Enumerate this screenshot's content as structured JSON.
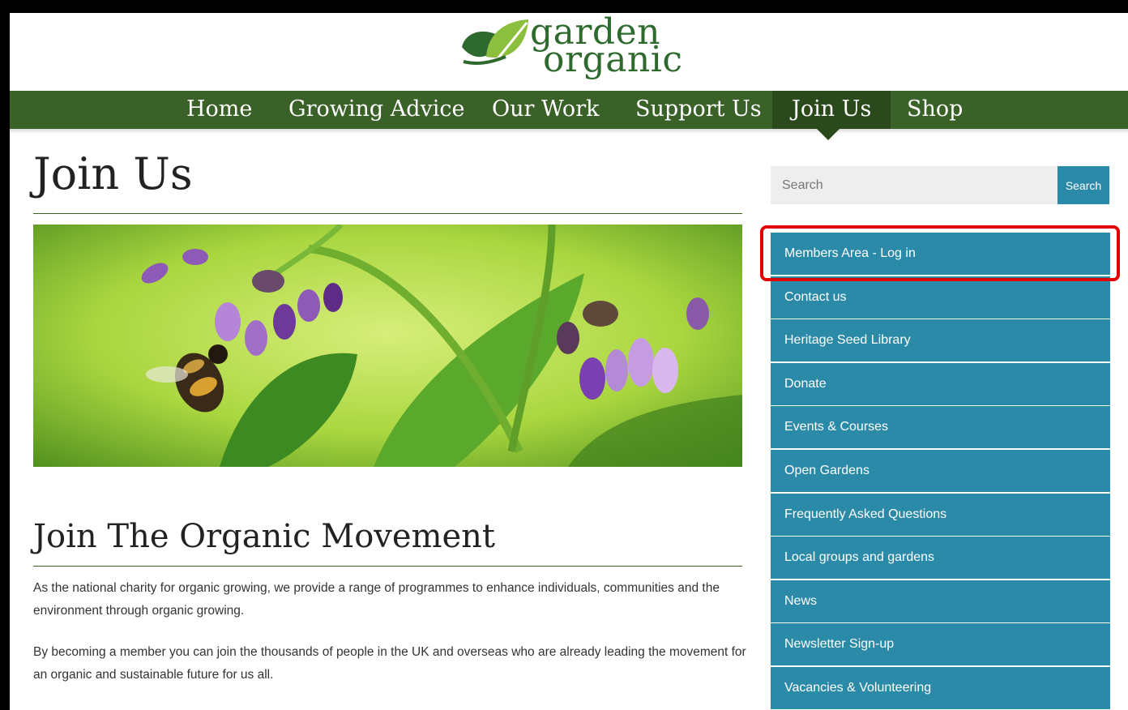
{
  "logo": {
    "line1": "garden",
    "line2": "organic"
  },
  "nav": {
    "items": [
      {
        "label": "Home",
        "active": false
      },
      {
        "label": "Growing Advice",
        "active": false
      },
      {
        "label": "Our Work",
        "active": false
      },
      {
        "label": "Support Us",
        "active": false
      },
      {
        "label": "Join Us",
        "active": true
      },
      {
        "label": "Shop",
        "active": false
      }
    ]
  },
  "main": {
    "title": "Join Us",
    "hero_icon": "bee-on-comfrey-flowers",
    "section_title": "Join The Organic Movement",
    "paragraphs": [
      "As the national charity for organic growing, we provide a range of programmes to enhance individuals, communities and the environment through organic growing.",
      "By becoming a member you can join the thousands of people in the UK and overseas who are already leading the movement for an organic and sustainable future for us all."
    ]
  },
  "sidebar": {
    "search": {
      "placeholder": "Search",
      "button_label": "Search"
    },
    "menu": [
      {
        "label": "Members Area - Log in",
        "highlighted": true
      },
      {
        "label": "Contact us"
      },
      {
        "label": "Heritage Seed Library"
      },
      {
        "label": "Donate"
      },
      {
        "label": "Events & Courses"
      },
      {
        "label": "Open Gardens"
      },
      {
        "label": "Frequently Asked Questions"
      },
      {
        "label": "Local groups and gardens"
      },
      {
        "label": "News"
      },
      {
        "label": "Newsletter Sign-up"
      },
      {
        "label": "Vacancies & Volunteering"
      }
    ]
  },
  "colors": {
    "nav_bg": "#3a6128",
    "nav_active": "#2b4a1c",
    "sidebar_blue": "#2a8aa8",
    "logo_green": "#2e6a2e",
    "highlight_red": "#e00000"
  }
}
